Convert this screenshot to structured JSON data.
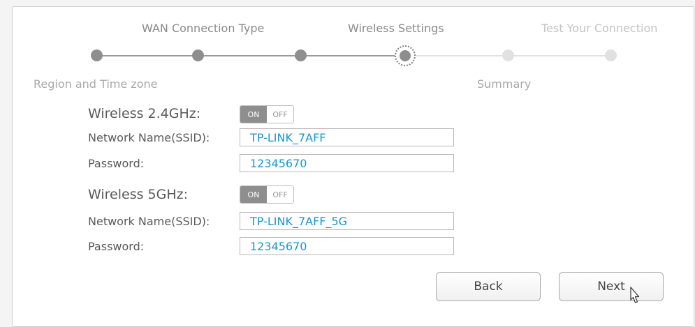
{
  "steps": {
    "top_labels": [
      "WAN Connection Type",
      "Wireless Settings",
      "Test Your Connection"
    ],
    "bottom_labels": [
      "Region and Time zone",
      "Summary"
    ],
    "current_step": 4,
    "total_steps": 6
  },
  "wireless_24": {
    "title": "Wireless 2.4GHz:",
    "toggle_on": "ON",
    "toggle_off": "OFF",
    "ssid_label": "Network Name(SSID):",
    "ssid_value": "TP-LINK_7AFF",
    "password_label": "Password:",
    "password_value": "12345670"
  },
  "wireless_5": {
    "title": "Wireless 5GHz:",
    "toggle_on": "ON",
    "toggle_off": "OFF",
    "ssid_label": "Network Name(SSID):",
    "ssid_value": "TP-LINK_7AFF_5G",
    "password_label": "Password:",
    "password_value": "12345670"
  },
  "buttons": {
    "back": "Back",
    "next": "Next"
  },
  "colors": {
    "input_text": "#1b95d3",
    "step_done": "#8e8e8e",
    "step_todo": "#e1e1e1"
  },
  "icons": {
    "cursor": "mouse-pointer-icon"
  }
}
